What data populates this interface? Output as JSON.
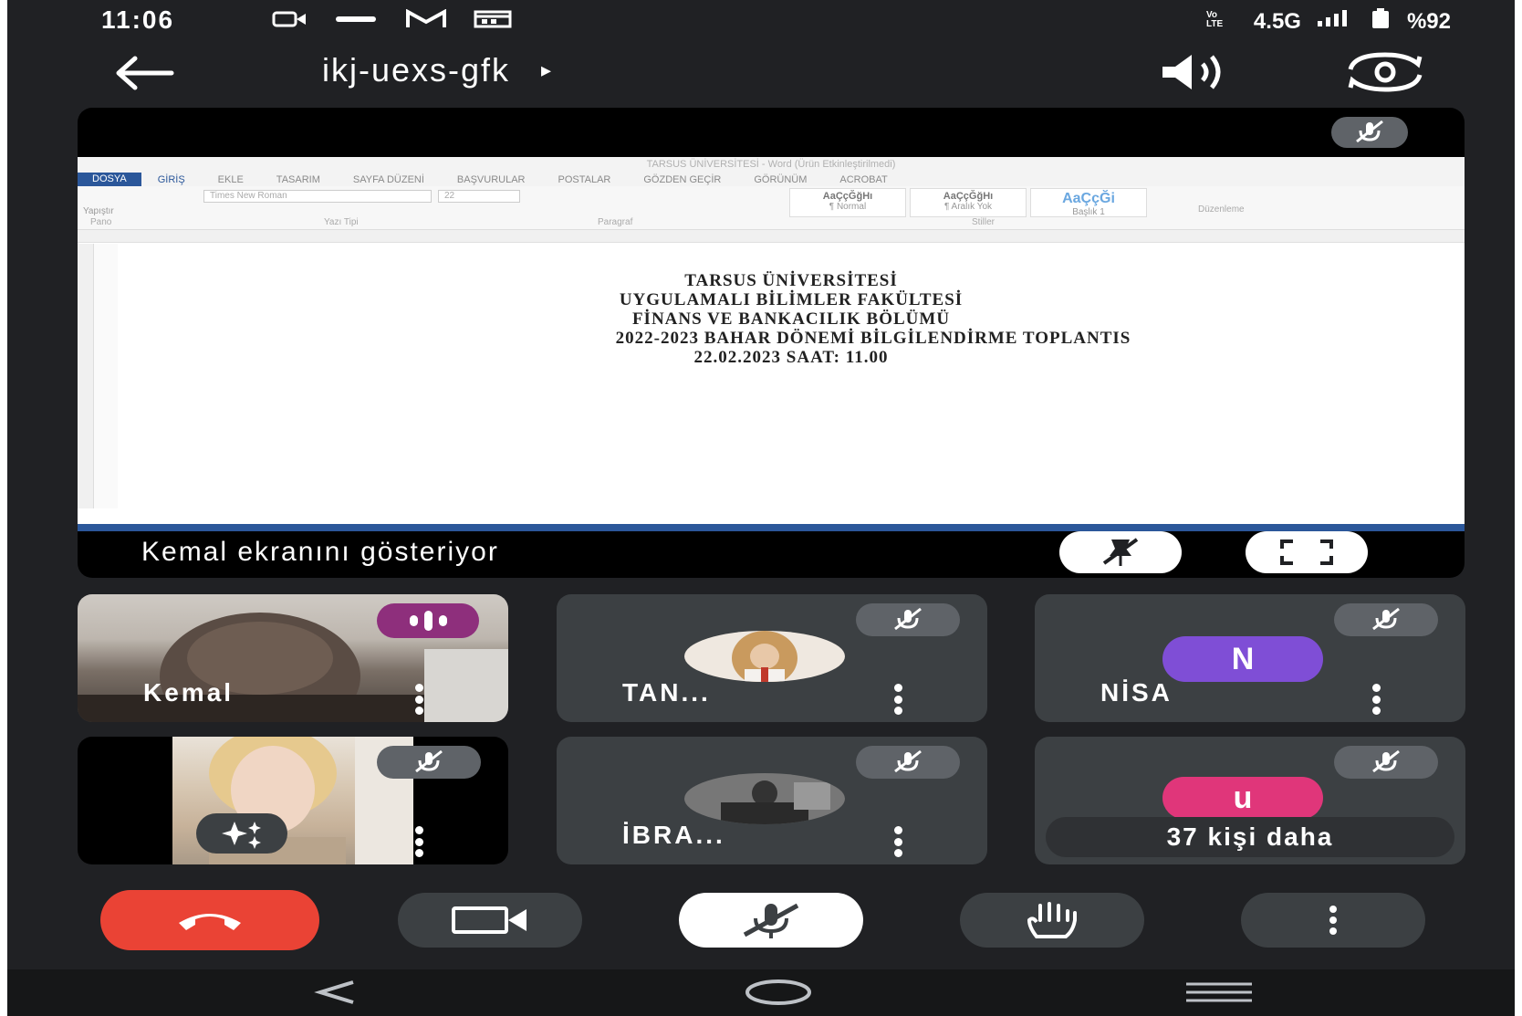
{
  "status_bar": {
    "time": "11:06",
    "network": "4.5G",
    "battery": "%92",
    "icons": [
      "video-record-icon",
      "turknet-icon",
      "gmail-icon",
      "calendar-icon",
      "volte-icon",
      "signal-icon",
      "battery-icon"
    ]
  },
  "header": {
    "meeting_code": "ikj-uexs-gfk",
    "play_indicator": "▸",
    "icons": [
      "back-arrow-icon",
      "speaker-icon",
      "switch-camera-icon"
    ]
  },
  "share": {
    "label": "Kemal ekranını gösteriyor",
    "word": {
      "title_bar": "TARSUS ÜNİVERSİTESİ - Word (Ürün Etkinleştirilmedi)",
      "tabs": [
        "DOSYA",
        "GİRİŞ",
        "EKLE",
        "TASARIM",
        "SAYFA DÜZENİ",
        "BAŞVURULAR",
        "POSTALAR",
        "GÖZDEN GEÇİR",
        "GÖRÜNÜM",
        "ACROBAT"
      ],
      "font_name": "Times New Roman",
      "font_size": "22",
      "styles": [
        {
          "sample": "AaÇçĞğHı",
          "name": "¶ Normal"
        },
        {
          "sample": "AaÇçĞğHı",
          "name": "¶ Aralık Yok"
        },
        {
          "sample": "AaÇçĞi",
          "name": "Başlık 1"
        }
      ],
      "groups": [
        "Pano",
        "Yazı Tipi",
        "Paragraf",
        "Stiller",
        "Düzenleme"
      ],
      "paste_label": "Yapıştır",
      "document_lines": [
        "TARSUS ÜNİVERSİTESİ",
        "UYGULAMALI BİLİMLER FAKÜLTESİ",
        "FİNANS VE BANKACILIK BÖLÜMÜ",
        "2022-2023 BAHAR DÖNEMİ BİLGİLENDİRME TOPLANTIS",
        "22.02.2023 SAAT: 11.00"
      ]
    }
  },
  "participants": [
    {
      "name": "Kemal",
      "type": "video",
      "state": "speaking"
    },
    {
      "name": "TAN...",
      "type": "photo",
      "state": "muted"
    },
    {
      "name": "NİSA",
      "type": "letter",
      "letter": "N",
      "color": "#7f4ed6",
      "state": "muted"
    },
    {
      "name": "",
      "type": "self-video",
      "state": "muted"
    },
    {
      "name": "İBRA...",
      "type": "photo",
      "state": "muted"
    },
    {
      "name": "37 kişi daha",
      "type": "letter",
      "letter": "u",
      "color": "#e0367a",
      "state": "muted"
    }
  ],
  "controls": [
    "end-call",
    "camera",
    "microphone",
    "raise-hand",
    "more-options"
  ],
  "colors": {
    "end_call": "#ea4335",
    "background": "#202124",
    "tile": "#3c4043",
    "speaking": "#8e2f7c"
  }
}
